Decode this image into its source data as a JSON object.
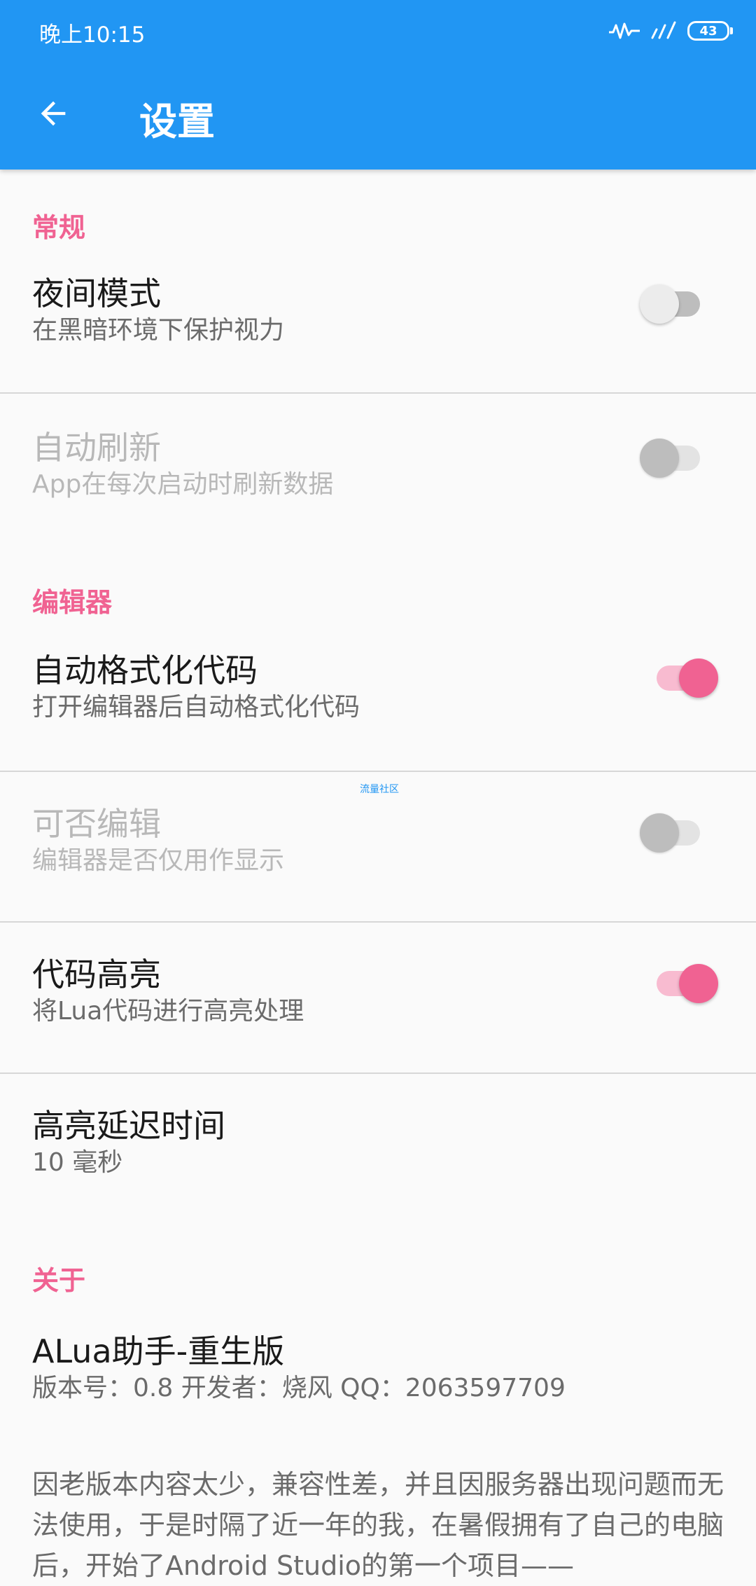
{
  "status_bar": {
    "time": "晚上10:15",
    "battery": "43"
  },
  "appbar": {
    "title": "设置"
  },
  "sections": {
    "general": {
      "header": "常规",
      "night_mode": {
        "title": "夜间模式",
        "summary": "在黑暗环境下保护视力",
        "enabled": false
      },
      "auto_refresh": {
        "title": "自动刷新",
        "summary": "App在每次启动时刷新数据",
        "enabled": false,
        "disabled": true
      }
    },
    "editor": {
      "header": "编辑器",
      "auto_format": {
        "title": "自动格式化代码",
        "summary": "打开编辑器后自动格式化代码",
        "enabled": true
      },
      "editable": {
        "title": "可否编辑",
        "summary": "编辑器是否仅用作显示",
        "enabled": false,
        "disabled": true
      },
      "highlight": {
        "title": "代码高亮",
        "summary": "将Lua代码进行高亮处理",
        "enabled": true
      },
      "highlight_delay": {
        "title": "高亮延迟时间",
        "summary": "10 毫秒"
      }
    },
    "about": {
      "header": "关于",
      "app": {
        "title": "ALua助手-重生版",
        "summary": "版本号：0.8  开发者：烧风  QQ：2063597709"
      },
      "description": "因老版本内容太少，兼容性差，并且因服务器出现问题而无法使用，于是时隔了近一年的我，在暑假拥有了自己的电脑后，开始了Android Studio的第一个项目——"
    }
  },
  "watermark": "流量社区",
  "colors": {
    "primary": "#2196f3",
    "accent": "#f06292"
  }
}
